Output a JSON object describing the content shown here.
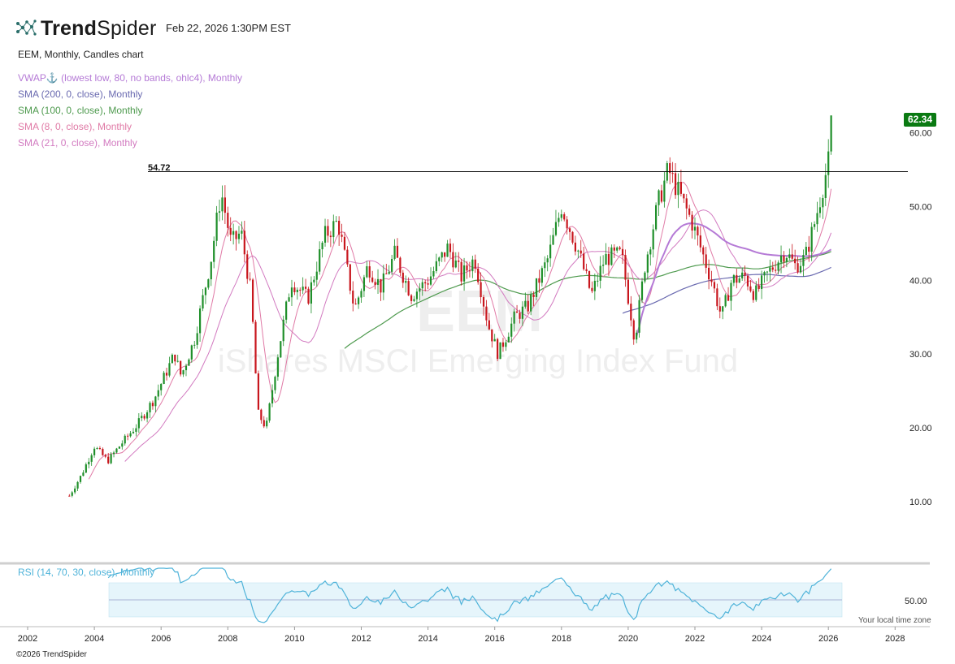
{
  "header": {
    "brand_bold": "Trend",
    "brand_light": "Spider",
    "timestamp": "Feb 22, 2026 1:30PM EST",
    "chart_title": "EEM, Monthly, Candles chart"
  },
  "indicators": [
    {
      "label": "VWAP⚓ (lowest low, 80, no bands, ohlc4), Monthly",
      "color": "#b57ad6"
    },
    {
      "label": "SMA (200, 0, close), Monthly",
      "color": "#6a6ab0"
    },
    {
      "label": "SMA (100, 0, close), Monthly",
      "color": "#4e9a4e"
    },
    {
      "label": "SMA (8, 0, close), Monthly",
      "color": "#e07aa6"
    },
    {
      "label": "SMA (21, 0, close), Monthly",
      "color": "#d27ac0"
    }
  ],
  "rsi_label": "RSI (14, 70, 30, close), Monthly",
  "rsi_color": "#4fb3d9",
  "last_price_label": "62.34",
  "level_label": "54.72",
  "watermark_ticker": "EEM",
  "watermark_name": "iShares MSCI Emerging Index Fund",
  "footer": {
    "copyright": "©2026 TrendSpider",
    "tz_note": "Your local time zone"
  },
  "colors": {
    "up": "#1f8f2a",
    "down": "#c8161d",
    "level_line": "#000000",
    "badge": "#0a7a12"
  },
  "chart_data": {
    "type": "candlestick",
    "ticker": "EEM",
    "interval": "Monthly",
    "x_ticks": [
      "2002",
      "2004",
      "2006",
      "2008",
      "2010",
      "2012",
      "2014",
      "2016",
      "2018",
      "2020",
      "2022",
      "2024",
      "2026",
      "2028"
    ],
    "y_ticks": [
      "10.00",
      "20.00",
      "30.00",
      "40.00",
      "50.00",
      "60.00"
    ],
    "xlim": [
      2002.0,
      2028.0
    ],
    "ylim": [
      5,
      65
    ],
    "horizontal_level": 54.72,
    "last_price": 62.34,
    "price_path": [
      [
        2003.25,
        10.8
      ],
      [
        2003.6,
        13.5
      ],
      [
        2004.0,
        17.5
      ],
      [
        2004.4,
        15.5
      ],
      [
        2004.8,
        17.8
      ],
      [
        2005.3,
        20.5
      ],
      [
        2005.8,
        24.0
      ],
      [
        2006.4,
        30.0
      ],
      [
        2006.6,
        27.0
      ],
      [
        2007.0,
        32.0
      ],
      [
        2007.5,
        43.0
      ],
      [
        2007.8,
        52.0
      ],
      [
        2008.1,
        45.0
      ],
      [
        2008.4,
        46.5
      ],
      [
        2008.7,
        38.0
      ],
      [
        2008.9,
        22.0
      ],
      [
        2009.15,
        20.0
      ],
      [
        2009.5,
        30.0
      ],
      [
        2009.9,
        40.0
      ],
      [
        2010.4,
        37.5
      ],
      [
        2010.9,
        46.0
      ],
      [
        2011.3,
        48.0
      ],
      [
        2011.8,
        36.0
      ],
      [
        2012.2,
        42.0
      ],
      [
        2012.6,
        39.0
      ],
      [
        2013.0,
        43.5
      ],
      [
        2013.5,
        38.0
      ],
      [
        2014.0,
        40.0
      ],
      [
        2014.6,
        44.5
      ],
      [
        2015.0,
        40.5
      ],
      [
        2015.4,
        43.0
      ],
      [
        2015.8,
        34.0
      ],
      [
        2016.1,
        30.0
      ],
      [
        2016.6,
        35.0
      ],
      [
        2017.0,
        36.5
      ],
      [
        2017.6,
        43.0
      ],
      [
        2018.0,
        50.0
      ],
      [
        2018.5,
        44.0
      ],
      [
        2018.9,
        38.0
      ],
      [
        2019.3,
        43.0
      ],
      [
        2019.8,
        43.5
      ],
      [
        2020.2,
        32.0
      ],
      [
        2020.5,
        42.0
      ],
      [
        2020.9,
        50.5
      ],
      [
        2021.2,
        55.0
      ],
      [
        2021.6,
        51.0
      ],
      [
        2021.9,
        48.0
      ],
      [
        2022.2,
        44.0
      ],
      [
        2022.5,
        40.0
      ],
      [
        2022.8,
        35.0
      ],
      [
        2023.1,
        40.0
      ],
      [
        2023.5,
        40.5
      ],
      [
        2023.8,
        38.0
      ],
      [
        2024.2,
        41.0
      ],
      [
        2024.7,
        44.0
      ],
      [
        2025.0,
        42.0
      ],
      [
        2025.3,
        43.0
      ],
      [
        2025.6,
        48.0
      ],
      [
        2025.9,
        54.0
      ],
      [
        2026.1,
        58.0
      ],
      [
        2026.15,
        62.34
      ]
    ],
    "series": [
      {
        "type": "rsi",
        "ylim": [
          0,
          100
        ],
        "reference_line": 50,
        "band": [
          30,
          70
        ]
      }
    ]
  }
}
